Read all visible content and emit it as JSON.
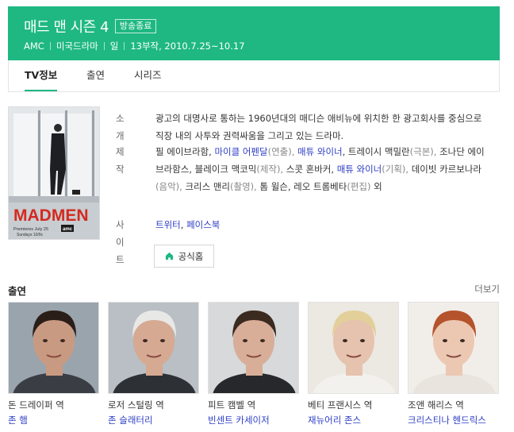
{
  "header": {
    "title": "매드 맨 시즌 4",
    "badge": "방송종료",
    "meta": [
      "AMC",
      "미국드라마",
      "일",
      "13부작, 2010.7.25~10.17"
    ]
  },
  "tabs": [
    {
      "label": "TV정보",
      "active": true
    },
    {
      "label": "출연",
      "active": false
    },
    {
      "label": "시리즈",
      "active": false
    }
  ],
  "poster": {
    "logo_text": "MADMEN",
    "premiere": "Premieres July 25",
    "time": "Sundays 10/9c",
    "network": "amc"
  },
  "info": {
    "synopsis_label": "소개",
    "synopsis": "광고의 대명사로 통하는 1960년대의 매디슨 애비뉴에 위치한 한 광고회사를 중심으로 직장 내의 사투와 권력싸움을 그리고 있는 드라마.",
    "production_label": "제작",
    "production": [
      {
        "text": "필 에이브라함, ",
        "style": "plain"
      },
      {
        "text": "마이클 어펜달",
        "style": "link"
      },
      {
        "text": "(연출), ",
        "style": "role"
      },
      {
        "text": "매튜 와이너",
        "style": "link"
      },
      {
        "text": ", 트레이시 맥밀란",
        "style": "plain"
      },
      {
        "text": "(극본), ",
        "style": "role"
      },
      {
        "text": "조나단 에이브라함스, 블레이크 맥코믹",
        "style": "plain"
      },
      {
        "text": "(제작), ",
        "style": "role"
      },
      {
        "text": "스콧 혼바커, ",
        "style": "plain"
      },
      {
        "text": "매튜 와이너",
        "style": "link"
      },
      {
        "text": "(기획), ",
        "style": "role"
      },
      {
        "text": "데이빗 카르보나라",
        "style": "plain"
      },
      {
        "text": "(음악), ",
        "style": "role"
      },
      {
        "text": "크리스 맨리",
        "style": "plain"
      },
      {
        "text": "(촬영), ",
        "style": "role"
      },
      {
        "text": "톰 윌슨, 레오 트롬베타",
        "style": "plain"
      },
      {
        "text": "(편집) ",
        "style": "role"
      },
      {
        "text": "외",
        "style": "plain"
      }
    ],
    "site_label": "사이트",
    "sites": [
      {
        "text": "트위터",
        "style": "link"
      },
      {
        "text": ", ",
        "style": "plain"
      },
      {
        "text": "페이스북",
        "style": "link"
      }
    ],
    "home_button": "공식홈"
  },
  "cast": {
    "title": "출연",
    "more": "더보기",
    "members": [
      {
        "role": "돈 드레이퍼 역",
        "actor": "존 햄",
        "skin": "#c99a82",
        "hair": "#2a1e18",
        "bg": "#9aa4ad",
        "suit": "#3a3e44"
      },
      {
        "role": "로저 스털링 역",
        "actor": "존 슬래터리",
        "skin": "#d6a993",
        "hair": "#e8e8e6",
        "bg": "#b9bfc4",
        "suit": "#2d3035"
      },
      {
        "role": "피트 캠벨 역",
        "actor": "빈센트 카세이저",
        "skin": "#d8ae98",
        "hair": "#3a2a20",
        "bg": "#d7d9da",
        "suit": "#26282c"
      },
      {
        "role": "베티 프랜시스 역",
        "actor": "재뉴어리 존스",
        "skin": "#e6c3ae",
        "hair": "#e3cf9a",
        "bg": "#ece8e2",
        "suit": "#f3f1ee"
      },
      {
        "role": "조앤 해리스 역",
        "actor": "크리스티나 헨드릭스",
        "skin": "#ecc8b2",
        "hair": "#b5532c",
        "bg": "#f1eeea",
        "suit": "#e9e4de"
      }
    ]
  }
}
